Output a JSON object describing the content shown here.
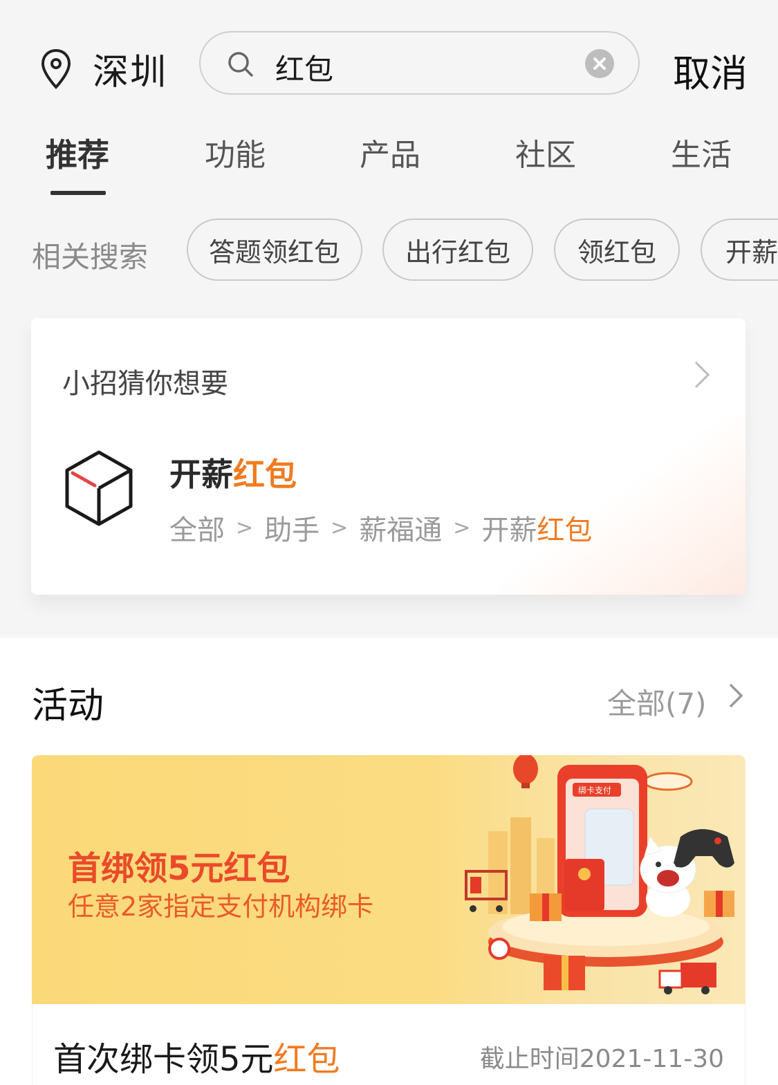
{
  "header": {
    "city": "深圳",
    "search_query": "红包",
    "cancel_label": "取消"
  },
  "tabs": [
    {
      "label": "推荐",
      "active": true
    },
    {
      "label": "功能"
    },
    {
      "label": "产品"
    },
    {
      "label": "社区"
    },
    {
      "label": "生活"
    }
  ],
  "related": {
    "label": "相关搜索",
    "chips": [
      "答题领红包",
      "出行红包",
      "领红包",
      "开薪"
    ]
  },
  "guess": {
    "title": "小招猜你想要",
    "item_name_prefix": "开薪",
    "item_name_highlight": "红包",
    "path": [
      "全部",
      "助手",
      "薪福通",
      "开薪"
    ],
    "path_highlight": "红包"
  },
  "activity": {
    "title": "活动",
    "all_label": "全部(7)",
    "banner": {
      "headline": "首绑领5元红包",
      "subline": "任意2家指定支付机构绑卡",
      "phone_label": "绑卡支付"
    },
    "card_title_prefix": "首次绑卡领5元",
    "card_title_highlight": "红包",
    "deadline": "截止时间2021-11-30"
  },
  "colors": {
    "accent": "#f07b20",
    "banner_text": "#ea4a2a",
    "background": "#f5f5f5"
  }
}
